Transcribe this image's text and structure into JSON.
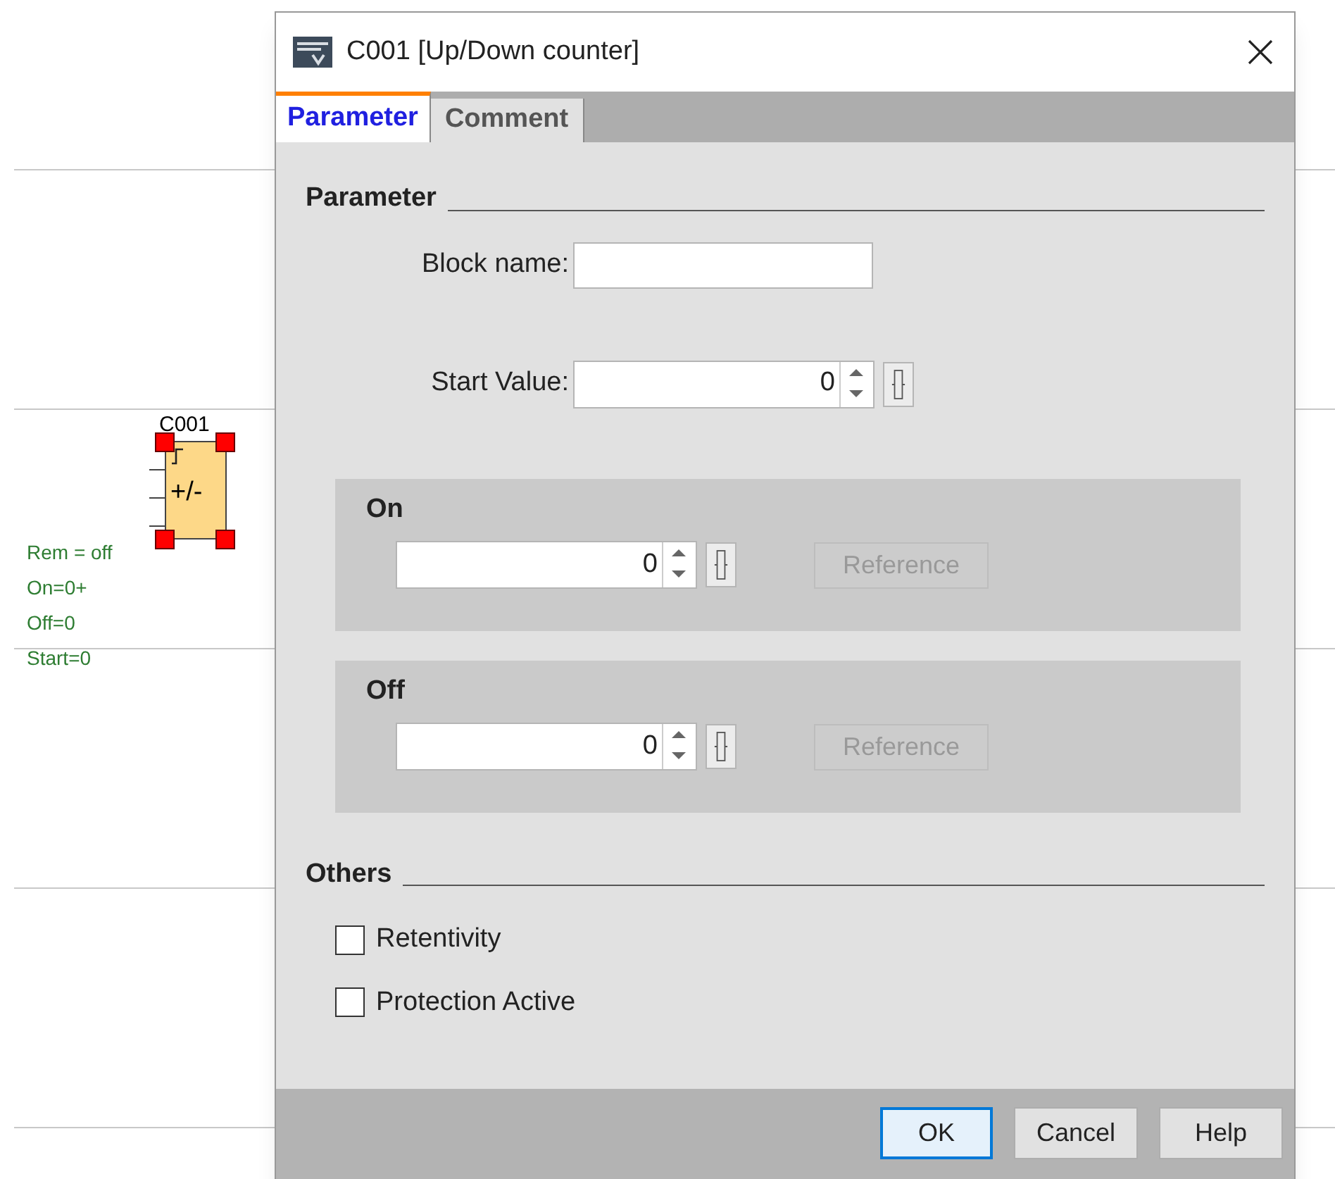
{
  "canvas": {
    "block": {
      "label": "C001",
      "symbol": "+/-",
      "selected": true
    },
    "annotations": [
      "Rem = off",
      "On=0+",
      "Off=0",
      "Start=0"
    ]
  },
  "window": {
    "title": "C001 [Up/Down counter]"
  },
  "tabs": [
    {
      "label": "Parameter",
      "selected": true
    },
    {
      "label": "Comment",
      "selected": false
    }
  ],
  "parameter": {
    "heading": "Parameter",
    "block_name": {
      "label": "Block name:"
    },
    "start_value": {
      "label": "Start Value:",
      "value": "0"
    }
  },
  "groups": [
    {
      "title": "On",
      "value": "0",
      "reference": {
        "label": "Reference",
        "disabled": true
      }
    },
    {
      "title": "Off",
      "value": "0",
      "reference": {
        "label": "Reference",
        "disabled": true
      }
    }
  ],
  "others": {
    "heading": "Others",
    "options": [
      {
        "label": "Retentivity",
        "checked": false
      },
      {
        "label": "Protection Active",
        "checked": false
      }
    ]
  },
  "buttons": [
    {
      "label": "OK",
      "default": true
    },
    {
      "label": "Cancel",
      "default": false
    },
    {
      "label": "Help",
      "default": false
    }
  ]
}
